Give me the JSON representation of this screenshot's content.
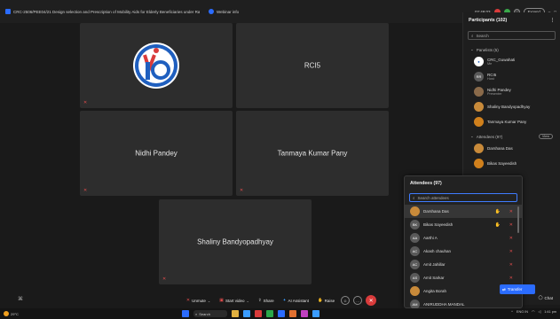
{
  "titlebar": {
    "title": "CRC-2506/PEE04/21 Design selection and Prescription of Mobility Aids for Elderly Beneficiaries under Rashtriya...",
    "webinar_info": "Webinar info",
    "time": "02:49:03",
    "expand": "Expand"
  },
  "tiles": [
    {
      "name": "",
      "type": "logo"
    },
    {
      "name": "RCI5"
    },
    {
      "name": "Nidhi Pandey"
    },
    {
      "name": "Tanmaya Kumar Pany"
    },
    {
      "name": "Shaliny Bandyopadhyay"
    }
  ],
  "participants_panel": {
    "title": "Participants (102)",
    "search_placeholder": "Search",
    "panelists_header": "Panelists (5)",
    "panelists": [
      {
        "name": "CRC_Guwahati",
        "sub": "Me",
        "avatar": "logo",
        "color": "#ffffff"
      },
      {
        "name": "RCI5",
        "sub": "Host",
        "avatar": "RR",
        "color": "#5a5a5a"
      },
      {
        "name": "Nidhi Pandey",
        "sub": "Presenter",
        "avatar": "photo",
        "color": "#8a6a4a"
      },
      {
        "name": "Shaliny Bandyopadhyay",
        "sub": "",
        "avatar": "photo",
        "color": "#c88a3a"
      },
      {
        "name": "Tanmaya Kumar Pany",
        "sub": "",
        "avatar": "photo",
        "color": "#d0801c"
      }
    ],
    "attendees_header": "Attendees (97)",
    "view_all": "View",
    "attendees": [
      {
        "name": "Darshana Das",
        "color": "#c88a3a",
        "avatar": "photo"
      },
      {
        "name": "Bikas Sayeedish",
        "color": "#d0801c",
        "avatar": "photo"
      }
    ]
  },
  "attendee_popup": {
    "title": "Attendees (97)",
    "search_placeholder": "Search attendees",
    "rows": [
      {
        "name": "Darshana Das",
        "avatar": "photo",
        "color": "#c88a3a"
      },
      {
        "name": "Bikas Sayeedish",
        "avatar": "BK",
        "color": "#5a5a5a"
      },
      {
        "name": "Aarthi A",
        "avatar": "AA",
        "color": "#5a5a5a"
      },
      {
        "name": "Akash chauhan",
        "avatar": "AC",
        "color": "#5a5a5a"
      },
      {
        "name": "Amit Jahillar",
        "avatar": "AC",
        "color": "#5a5a5a"
      },
      {
        "name": "Amit Sarkar",
        "avatar": "AS",
        "color": "#5a5a5a"
      },
      {
        "name": "Angita Borah",
        "avatar": "photo",
        "color": "#c88a3a"
      },
      {
        "name": "ANIRUDDHA MANDAL",
        "avatar": "AM",
        "color": "#5a5a5a"
      }
    ]
  },
  "toolbar": {
    "unmute": "Unmute",
    "start_video": "Start video",
    "share": "Share",
    "ai_assistant": "AI Assistant",
    "raise": "Raise",
    "chat": "Chat",
    "transfer": "Transfer"
  },
  "taskbar": {
    "weather": "29°C",
    "weather_sub": "Mostly cloudy",
    "search": "Search",
    "lang": "ENG IN",
    "time": "1:41 pm",
    "date": "24-03-2025"
  }
}
